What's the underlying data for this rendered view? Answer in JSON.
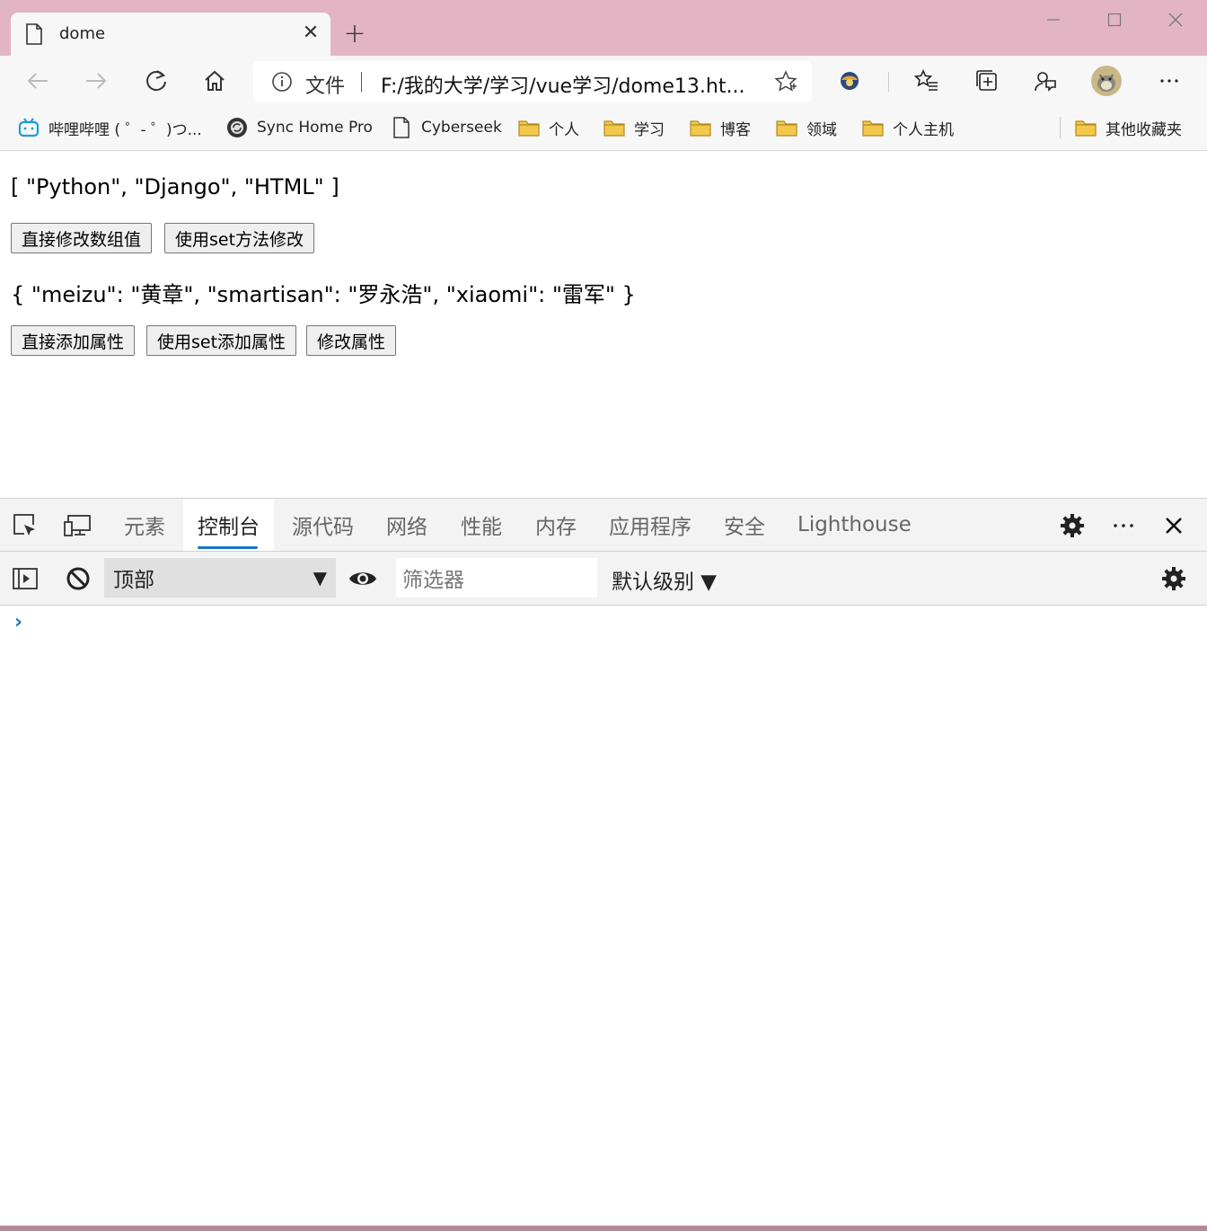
{
  "browser": {
    "tab_title": "dome",
    "new_tab_symbol": "+",
    "address": {
      "scheme_label": "文件",
      "url": "F:/我的大学/学习/vue学习/dome13.ht..."
    }
  },
  "bookmarks": [
    {
      "label": "哔哩哔哩 ( ゜- ゜)つ...",
      "icon": "bilibili-icon"
    },
    {
      "label": "Sync Home Pro",
      "icon": "sync-icon"
    },
    {
      "label": "Cyberseek",
      "icon": "page-icon"
    },
    {
      "label": "个人",
      "icon": "folder-icon"
    },
    {
      "label": "学习",
      "icon": "folder-icon"
    },
    {
      "label": "博客",
      "icon": "folder-icon"
    },
    {
      "label": "领域",
      "icon": "folder-icon"
    },
    {
      "label": "个人主机",
      "icon": "folder-icon"
    },
    {
      "label": "其他收藏夹",
      "icon": "folder-icon"
    }
  ],
  "page": {
    "array_text": "[ \"Python\", \"Django\", \"HTML\" ]",
    "array_buttons": [
      "直接修改数组值",
      "使用set方法修改"
    ],
    "object_text": "{ \"meizu\": \"黄章\", \"smartisan\": \"罗永浩\", \"xiaomi\": \"雷军\" }",
    "object_buttons": [
      "直接添加属性",
      "使用set添加属性",
      "修改属性"
    ]
  },
  "devtools": {
    "tabs": [
      "元素",
      "控制台",
      "源代码",
      "网络",
      "性能",
      "内存",
      "应用程序",
      "安全",
      "Lighthouse"
    ],
    "active_tab": "控制台",
    "console": {
      "context": "顶部",
      "filter_placeholder": "筛选器",
      "level": "默认级别 ▼",
      "prompt": "›"
    }
  },
  "colors": {
    "frame": "#e3b5c4",
    "toolbar": "#f7f7f7",
    "folder": "#f2c94c",
    "accent": "#1a73c8"
  }
}
